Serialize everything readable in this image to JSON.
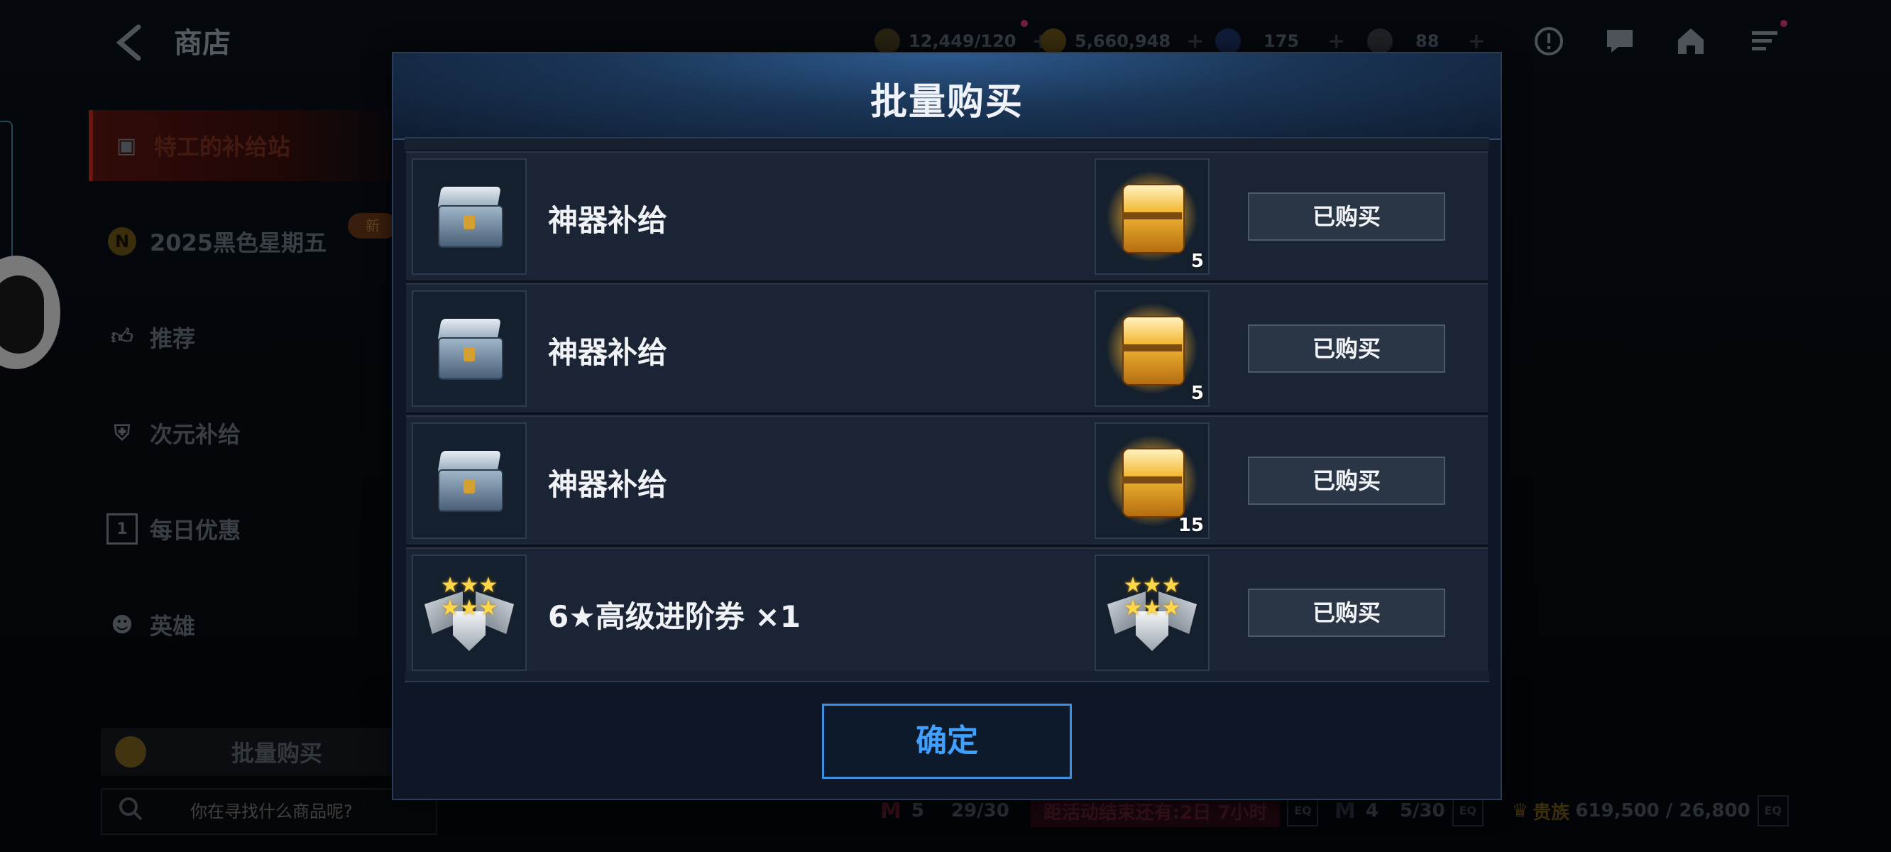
{
  "topbar": {
    "back_label": "<",
    "title": "商店",
    "resources": [
      {
        "name": "energy",
        "value": "12,449/120"
      },
      {
        "name": "gold",
        "value": "5,660,948"
      },
      {
        "name": "crystal",
        "value": "175"
      },
      {
        "name": "flame",
        "value": "88"
      }
    ]
  },
  "sidebar": {
    "items": [
      {
        "label": "特工的补给站",
        "active": true
      },
      {
        "label": "2025黑色星期五"
      },
      {
        "label": "推荐"
      },
      {
        "label": "次元补给"
      },
      {
        "label": "每日优惠"
      },
      {
        "label": "英雄"
      }
    ],
    "new_badge": "新",
    "n_badge": "N",
    "daily_icon_num": "1",
    "batch_label": "批量购买",
    "search_placeholder": "你在寻找什么商品呢?"
  },
  "bottom": {
    "m_count_a": "5",
    "progress_a": "29/30",
    "event_timer": "距活动结束还有:2日 7小时",
    "m_count_b": "4",
    "progress_b": "5/30",
    "noble_label": "贵族",
    "noble_value": "619,500 / 26,800",
    "eq_label": "EQ"
  },
  "modal": {
    "title": "批量购买",
    "rows": [
      {
        "name": "神器补给",
        "reward_count": "5",
        "status": "已购买"
      },
      {
        "name": "神器补给",
        "reward_count": "5",
        "status": "已购买"
      },
      {
        "name": "神器补给",
        "reward_count": "15",
        "status": "已购买"
      },
      {
        "name": "6★高级进阶券 ×1",
        "reward_count": "",
        "status": "已购买"
      }
    ],
    "confirm_label": "确定"
  },
  "colors": {
    "accent_blue": "#3fa0ff",
    "modal_bg": "#0f1726",
    "row_bg": "#1a2434",
    "button_bg": "#2a3646"
  }
}
